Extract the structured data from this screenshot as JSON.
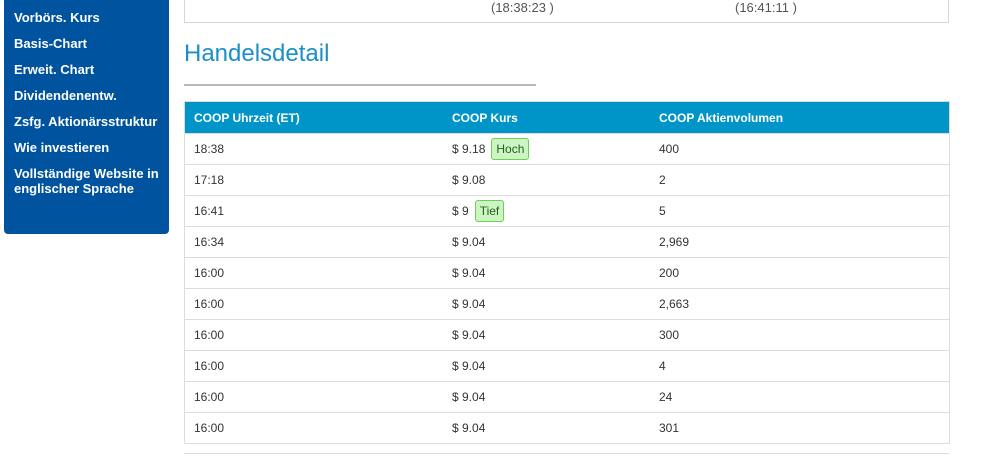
{
  "sidebar": {
    "items": [
      {
        "label": "Vorbörs. Kurs"
      },
      {
        "label": "Basis-Chart"
      },
      {
        "label": "Erweit. Chart"
      },
      {
        "label": "Dividendenentw."
      },
      {
        "label": "Zsfg. Aktionärsstruktur"
      },
      {
        "label": "Wie investieren"
      },
      {
        "label": "Vollständige Website in englischer Sprache"
      }
    ]
  },
  "top_box": {
    "time_left": "(18:38:23 )",
    "time_right": "(16:41:11 )"
  },
  "section": {
    "title": "Handelsdetail"
  },
  "table": {
    "headers": [
      "COOP Uhrzeit (ET)",
      "COOP Kurs",
      "COOP Aktienvolumen"
    ],
    "rows": [
      {
        "time": "18:38",
        "price": "$ 9.18",
        "badge": "Hoch",
        "volume": "400"
      },
      {
        "time": "17:18",
        "price": "$ 9.08",
        "badge": "",
        "volume": "2"
      },
      {
        "time": "16:41",
        "price": "$ 9",
        "badge": "Tief",
        "volume": "5"
      },
      {
        "time": "16:34",
        "price": "$ 9.04",
        "badge": "",
        "volume": "2,969"
      },
      {
        "time": "16:00",
        "price": "$ 9.04",
        "badge": "",
        "volume": "200"
      },
      {
        "time": "16:00",
        "price": "$ 9.04",
        "badge": "",
        "volume": "2,663"
      },
      {
        "time": "16:00",
        "price": "$ 9.04",
        "badge": "",
        "volume": "300"
      },
      {
        "time": "16:00",
        "price": "$ 9.04",
        "badge": "",
        "volume": "4"
      },
      {
        "time": "16:00",
        "price": "$ 9.04",
        "badge": "",
        "volume": "24"
      },
      {
        "time": "16:00",
        "price": "$ 9.04",
        "badge": "",
        "volume": "301"
      }
    ]
  }
}
